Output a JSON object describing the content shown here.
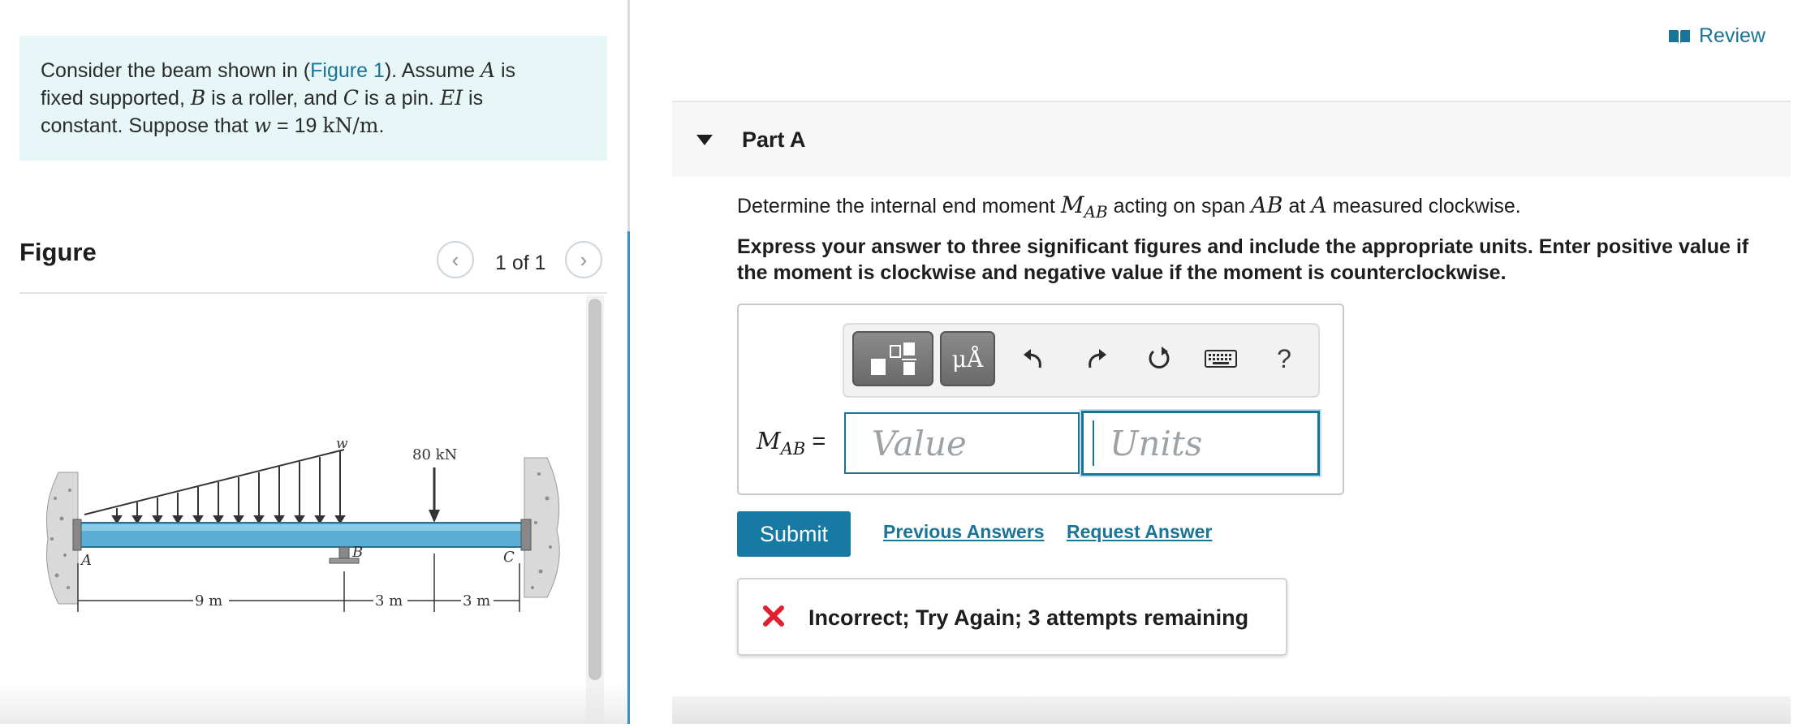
{
  "problem": {
    "intro_prefix": "Consider the beam shown in (",
    "figure_link": "Figure 1",
    "intro_suffix_1": "). Assume ",
    "var_a": "A",
    "intro_suffix_2": " is",
    "line2_prefix": "fixed supported, ",
    "var_b": "B",
    "line2_mid": " is a roller, and ",
    "var_c": "C",
    "line2_mid2": " is a pin. ",
    "var_ei": "EI",
    "line2_end": " is",
    "line3_prefix": "constant. Suppose that ",
    "var_w": "w",
    "line3_eq": " = 19 ",
    "unit": "kN/m",
    "line3_end": "."
  },
  "figure": {
    "heading": "Figure",
    "counter": "1 of 1",
    "load_w_label": "w",
    "point_load_label": "80 kN",
    "support_a_label": "A",
    "support_b_label": "B",
    "support_c_label": "C",
    "dim_1": "9 m",
    "dim_2": "3 m",
    "dim_3": "3 m"
  },
  "review": {
    "label": "Review"
  },
  "part": {
    "title": "Part A",
    "question_prefix": "Determine the internal end moment ",
    "question_var": "M",
    "question_sub": "AB",
    "question_mid": " acting on span ",
    "question_span": "AB",
    "question_mid2": " at ",
    "question_point": "A",
    "question_end": " measured clockwise.",
    "instructions": "Express your answer to three significant figures and include the appropriate units. Enter positive value if the moment is clockwise and negative value if the moment is counterclockwise."
  },
  "answer": {
    "label_var": "M",
    "label_sub": "AB",
    "label_eq": " =",
    "value_placeholder": "Value",
    "units_placeholder": "Units",
    "symbols_label": "μÅ",
    "help_label": "?"
  },
  "actions": {
    "submit": "Submit",
    "previous_answers": "Previous Answers",
    "request_answer": "Request Answer"
  },
  "feedback": {
    "message": "Incorrect; Try Again; 3 attempts remaining",
    "status_color": "#e0202e"
  },
  "colors": {
    "accent": "#1a7497",
    "submit": "#167aa3",
    "intro_bg": "#e7f6f7",
    "beam": "#5aaed3"
  }
}
